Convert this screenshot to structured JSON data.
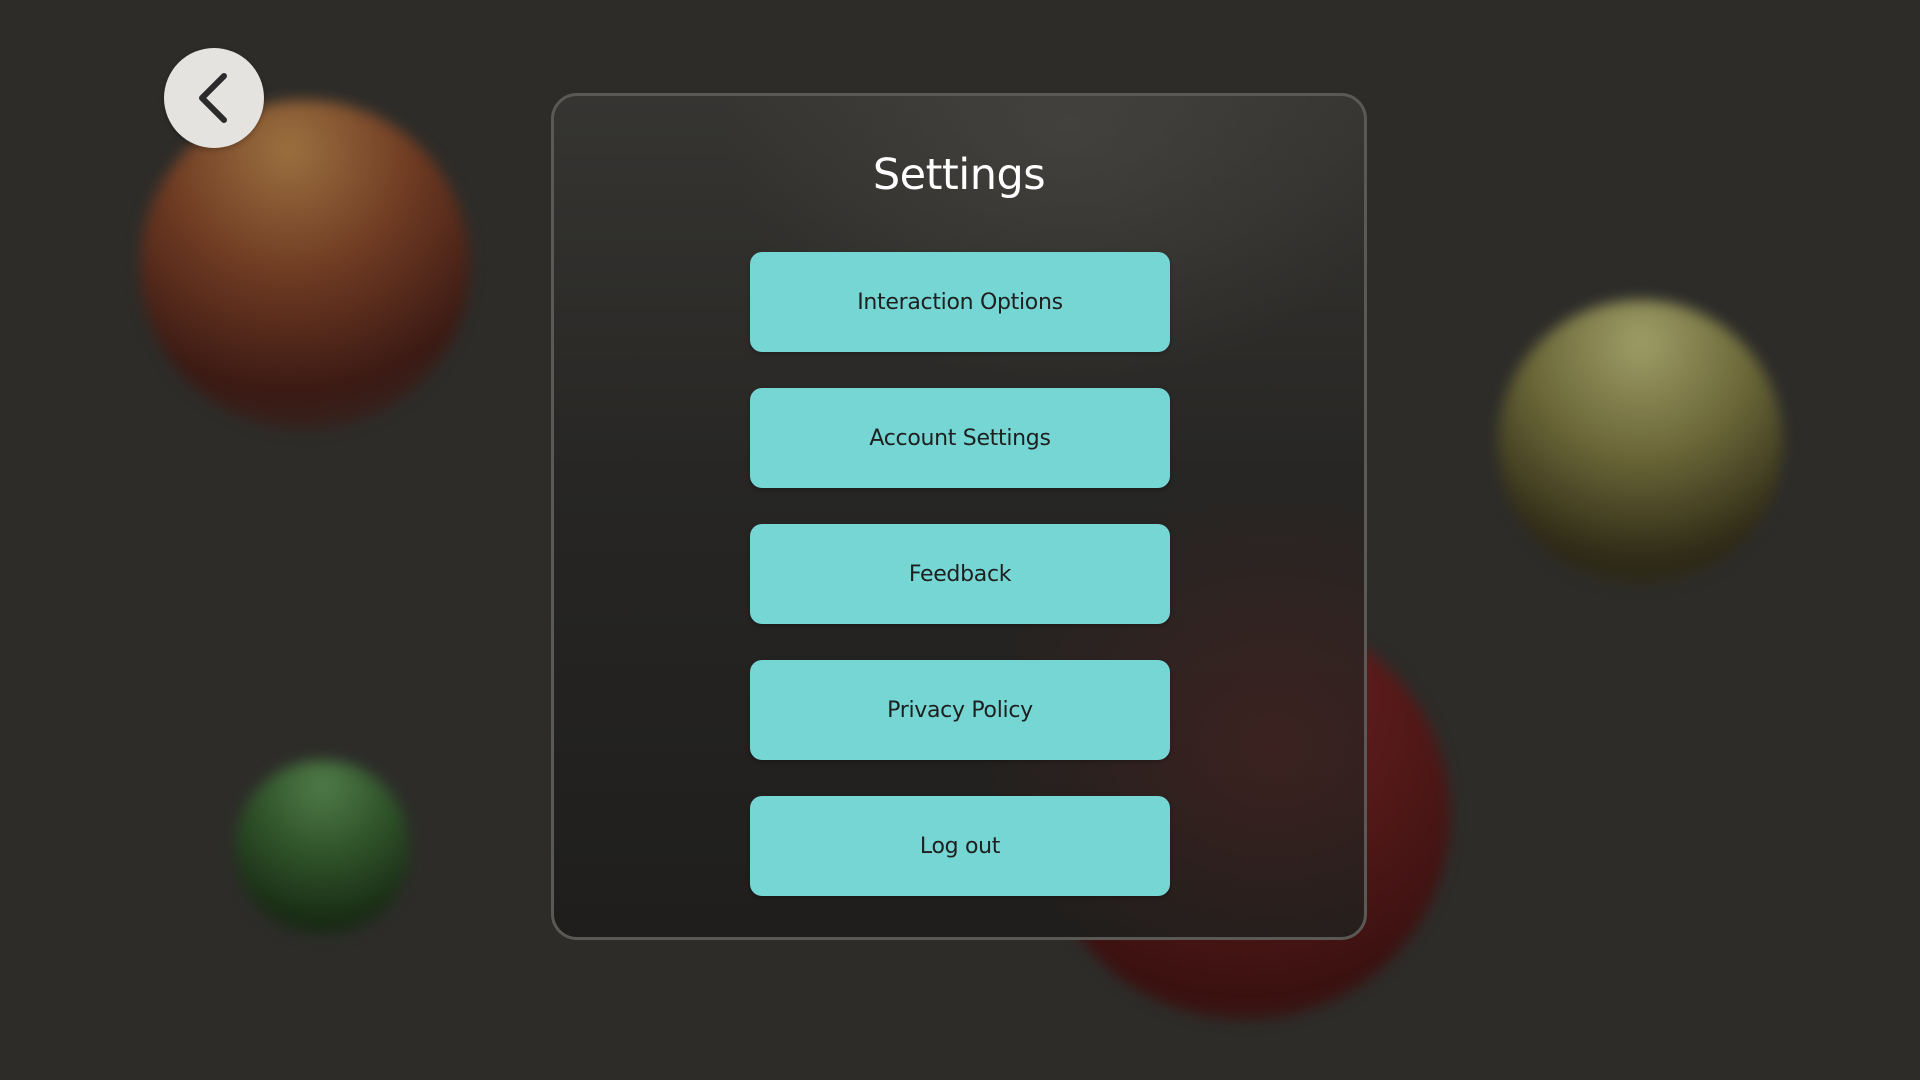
{
  "page": {
    "title": "Settings"
  },
  "back_button": {
    "icon": "chevron-left-icon"
  },
  "menu": {
    "items": [
      {
        "label": "Interaction Options"
      },
      {
        "label": "Account Settings"
      },
      {
        "label": "Feedback"
      },
      {
        "label": "Privacy Policy"
      },
      {
        "label": "Log out"
      }
    ]
  },
  "colors": {
    "background": "#2d2c29",
    "panel_border": "#5b5955",
    "button_accent": "#76d6d4",
    "button_text": "#1e1f1f",
    "title_text": "#ffffff",
    "back_button_bg": "#e5e3df"
  }
}
